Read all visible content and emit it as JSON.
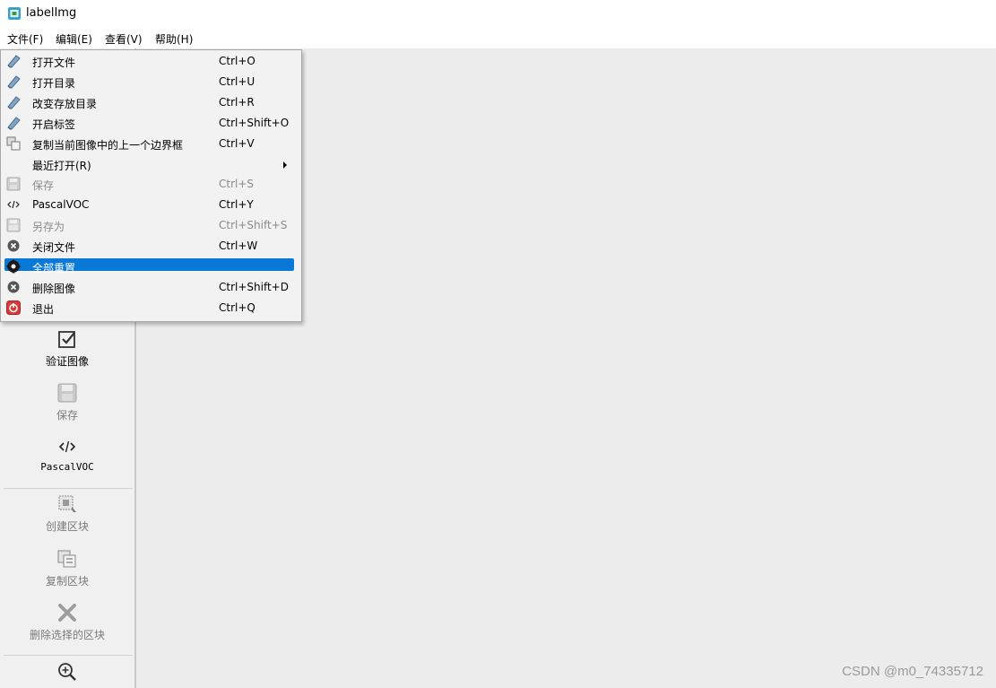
{
  "window": {
    "title": "labelImg"
  },
  "menubar": [
    {
      "label": "文件(F)"
    },
    {
      "label": "编辑(E)"
    },
    {
      "label": "查看(V)"
    },
    {
      "label": "帮助(H)"
    }
  ],
  "file_menu": [
    {
      "label": "打开文件",
      "shortcut": "Ctrl+O",
      "icon": "open-file-icon",
      "enabled": true
    },
    {
      "label": "打开目录",
      "shortcut": "Ctrl+U",
      "icon": "open-dir-icon",
      "enabled": true
    },
    {
      "label": "改变存放目录",
      "shortcut": "Ctrl+R",
      "icon": "change-save-dir-icon",
      "enabled": true
    },
    {
      "label": "开启标签",
      "shortcut": "Ctrl+Shift+O",
      "icon": "open-annotation-icon",
      "enabled": true
    },
    {
      "label": "复制当前图像中的上一个边界框",
      "shortcut": "Ctrl+V",
      "icon": "copy-box-icon",
      "enabled": true
    },
    {
      "label": "最近打开(R)",
      "shortcut": "",
      "icon": "",
      "enabled": true,
      "submenu": true
    },
    {
      "label": "保存",
      "shortcut": "Ctrl+S",
      "icon": "save-icon",
      "enabled": false
    },
    {
      "label": "PascalVOC",
      "shortcut": "Ctrl+Y",
      "icon": "code-icon",
      "enabled": true
    },
    {
      "label": "另存为",
      "shortcut": "Ctrl+Shift+S",
      "icon": "save-as-icon",
      "enabled": false
    },
    {
      "label": "关闭文件",
      "shortcut": "Ctrl+W",
      "icon": "close-file-icon",
      "enabled": true
    },
    {
      "label": "全部重置",
      "shortcut": "",
      "icon": "reset-all-icon",
      "enabled": true,
      "highlighted": true
    },
    {
      "label": "删除图像",
      "shortcut": "Ctrl+Shift+D",
      "icon": "delete-image-icon",
      "enabled": true
    },
    {
      "label": "退出",
      "shortcut": "Ctrl+Q",
      "icon": "quit-icon",
      "enabled": true
    }
  ],
  "toolbar": {
    "verify": "验证图像",
    "save": "保存",
    "format": "PascalVOC",
    "create_box": "创建区块",
    "duplicate_box": "复制区块",
    "delete_box": "删除选择的区块"
  },
  "watermark": "CSDN @m0_74335712",
  "colors": {
    "highlight": "#0a78d7",
    "canvas": "#ececec",
    "disabled_text": "#8a8a8a"
  }
}
